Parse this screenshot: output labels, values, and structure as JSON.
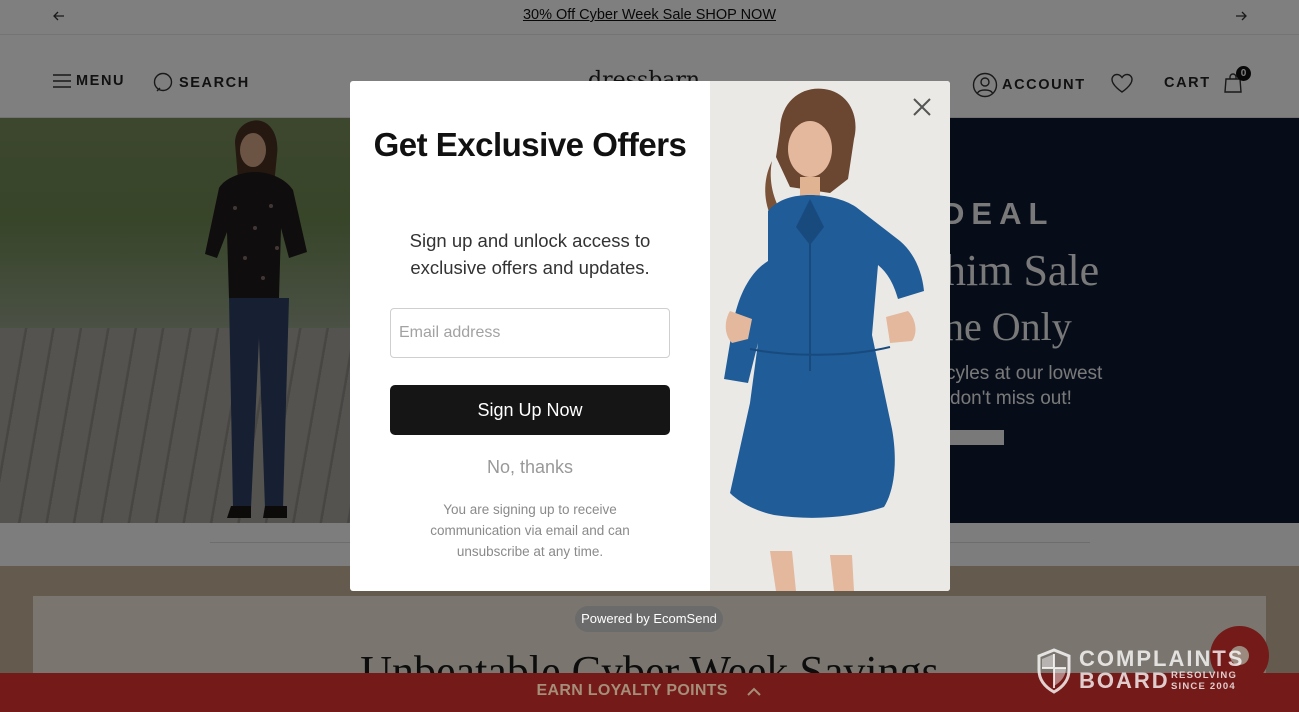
{
  "announcement": {
    "text": "30% Off Cyber Week Sale SHOP NOW",
    "prev_icon": "arrow-left-icon",
    "next_icon": "arrow-right-icon"
  },
  "header": {
    "menu_label": "MENU",
    "search_label": "SEARCH",
    "logo_text": "dressbarn",
    "account_label": "ACCOUNT",
    "cart_label": "CART",
    "cart_count": "0"
  },
  "hero_right": {
    "line1": "DEAL",
    "line2": "him Sale",
    "line3": "ne Only",
    "line4": "cyles at our lowest",
    "line5": "don't miss out!"
  },
  "banner": {
    "headline": "Unbeatable Cyber Week Savings"
  },
  "modal": {
    "title": "Get Exclusive Offers",
    "subtitle": "Sign up and unlock access to exclusive offers and updates.",
    "email_placeholder": "Email address",
    "signup_label": "Sign Up Now",
    "no_thanks_label": "No, thanks",
    "legal": "You are signing up to receive communication via email and can unsubscribe at any time.",
    "close_icon": "close-icon"
  },
  "powered_by": "Powered by EcomSend",
  "loyalty": {
    "label": "EARN LOYALTY POINTS"
  },
  "watermark": {
    "line1": "COMPLAINTS",
    "line2": "BOARD",
    "small1": "RESOLVING",
    "small2": "SINCE 2004"
  },
  "colors": {
    "loyalty_bar": "#741a18",
    "signup_button": "#151515",
    "hero_right_bg": "#0d1b33",
    "dress": "#1f5c98"
  }
}
